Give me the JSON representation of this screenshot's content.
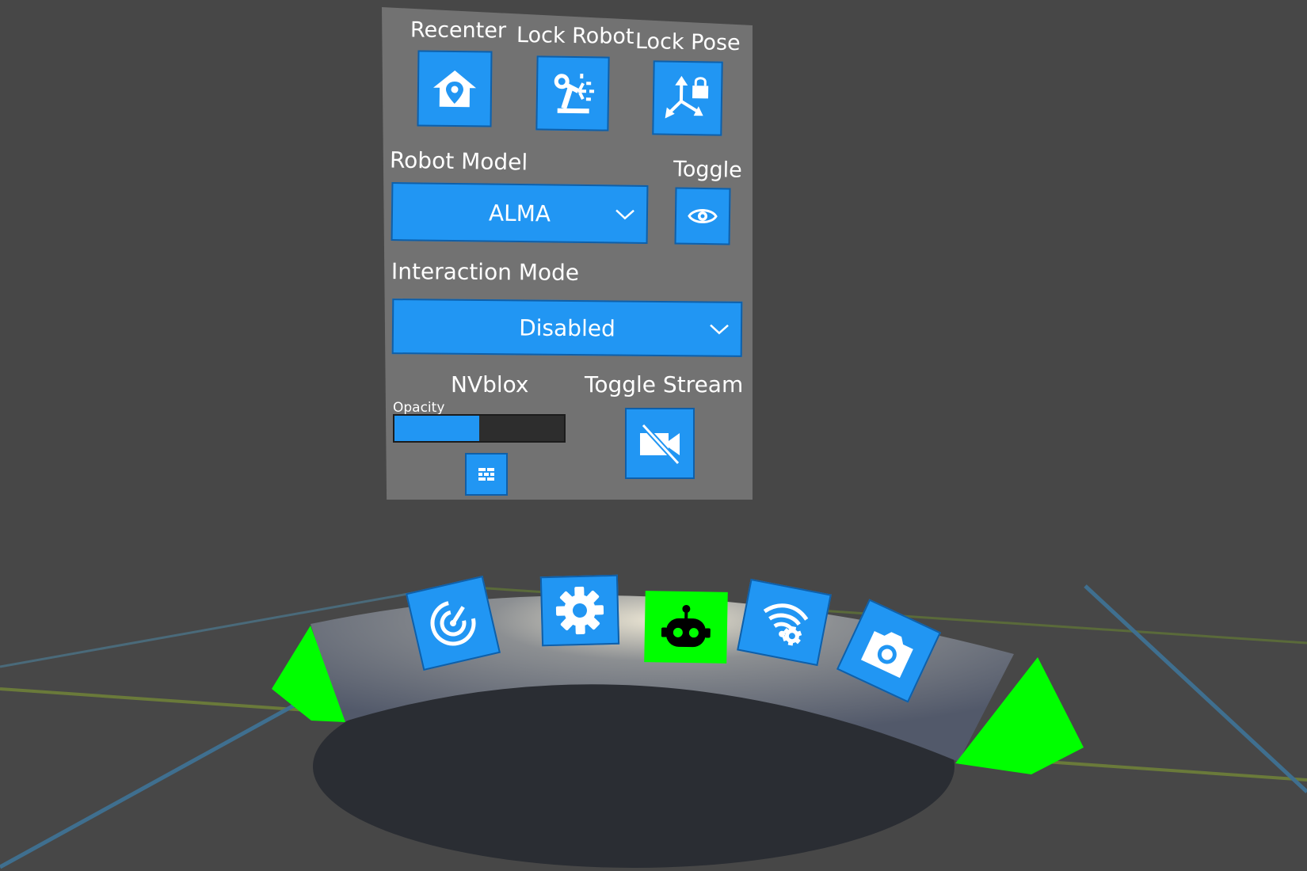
{
  "panel": {
    "recenter_label": "Recenter",
    "lock_robot_label": "Lock Robot",
    "lock_pose_label": "Lock Pose",
    "robot_model_label": "Robot Model",
    "robot_model_value": "ALMA",
    "toggle_label": "Toggle",
    "interaction_mode_label": "Interaction Mode",
    "interaction_mode_value": "Disabled",
    "nvblox_label": "NVblox",
    "opacity_label": "Opacity",
    "opacity_value": 0.5,
    "toggle_stream_label": "Toggle Stream"
  },
  "icons": {
    "recenter": "home-pin-icon",
    "lock_robot": "robot-arm-icon",
    "lock_pose": "axes-lock-icon",
    "toggle": "eye-icon",
    "nvblox": "bricks-icon",
    "toggle_stream": "video-off-icon"
  },
  "hand_menu": {
    "items": [
      {
        "icon": "radar-icon",
        "state": "default"
      },
      {
        "icon": "gear-icon",
        "state": "default"
      },
      {
        "icon": "robot-icon",
        "state": "active"
      },
      {
        "icon": "wifi-settings-icon",
        "state": "default"
      },
      {
        "icon": "camera-icon",
        "state": "default"
      }
    ]
  },
  "colors": {
    "button_blue": "#2196f3",
    "active_green": "#00ff00",
    "panel_gray": "#727272",
    "background": "#474747"
  }
}
